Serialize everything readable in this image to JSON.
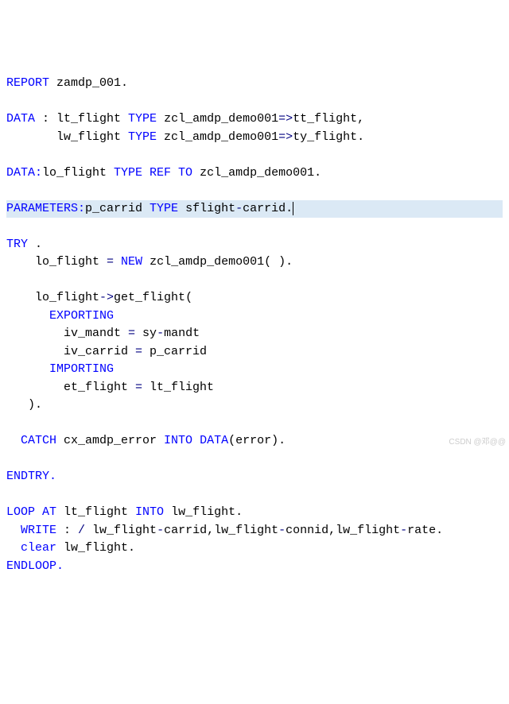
{
  "t": {
    "report": "REPORT",
    "zamdp": "zamdp_001.",
    "data1": "DATA",
    "colon1": " : ",
    "ltflight": "lt_flight ",
    "type1": "TYPE",
    "zcl1": " zcl_amdp_demo001",
    "arrow1": "=>",
    "ttflight": "tt_flight,",
    "lwflight": "lw_flight ",
    "type2": "TYPE",
    "zcl2": " zcl_amdp_demo001",
    "arrow2": "=>",
    "tyflight": "ty_flight.",
    "data2": "DATA:",
    "loflight": "lo_flight ",
    "typeref": "TYPE REF TO",
    "zcl3": " zcl_amdp_demo001.",
    "params": "PARAMETERS:",
    "pcarrid": "p_carrid ",
    "type3": "TYPE",
    "sflight": " sflight",
    "dash1": "-",
    "carrid": "carrid.",
    "try": "TRY",
    "dot": " .",
    "loflight2": "    lo_flight ",
    "eq1": "=",
    "new": " NEW",
    "zcl4": " zcl_amdp_demo001",
    "parens1": "( ).",
    "loflight3": "    lo_flight",
    "arrow3": "->",
    "getflight": "get_flight",
    "open": "(",
    "exporting": "      EXPORTING",
    "ivmandt": "        iv_mandt ",
    "eq2": "=",
    "symandt": " sy",
    "dash2": "-",
    "mandt": "mandt",
    "ivcarrid": "        iv_carrid ",
    "eq3": "=",
    "pcarrid2": " p_carrid",
    "importing": "      IMPORTING",
    "etflight": "        et_flight ",
    "eq4": "=",
    "ltflight2": " lt_flight",
    "close": "   ).",
    "catch": "  CATCH",
    "cxamdp": " cx_amdp_error ",
    "into": "INTO",
    "datafn": " DATA",
    "error": "(error).",
    "endtry": "ENDTRY.",
    "loop": "LOOP AT",
    "ltflight3": " lt_flight ",
    "into2": "INTO",
    "lwflight2": " lw_flight.",
    "write": "  WRITE",
    "colon2": " : ",
    "slash": "/",
    "lwcarrid": " lw_flight",
    "d3": "-",
    "carrid2": "carrid,",
    "lwconnid": "lw_flight",
    "d4": "-",
    "connid": "connid,",
    "lwrate": "lw_flight",
    "d5": "-",
    "rate": "rate.",
    "clear": "  clear",
    "lwflight3": " lw_flight.",
    "endloop": "ENDLOOP.",
    "watermark": "CSDN @邓@@"
  }
}
